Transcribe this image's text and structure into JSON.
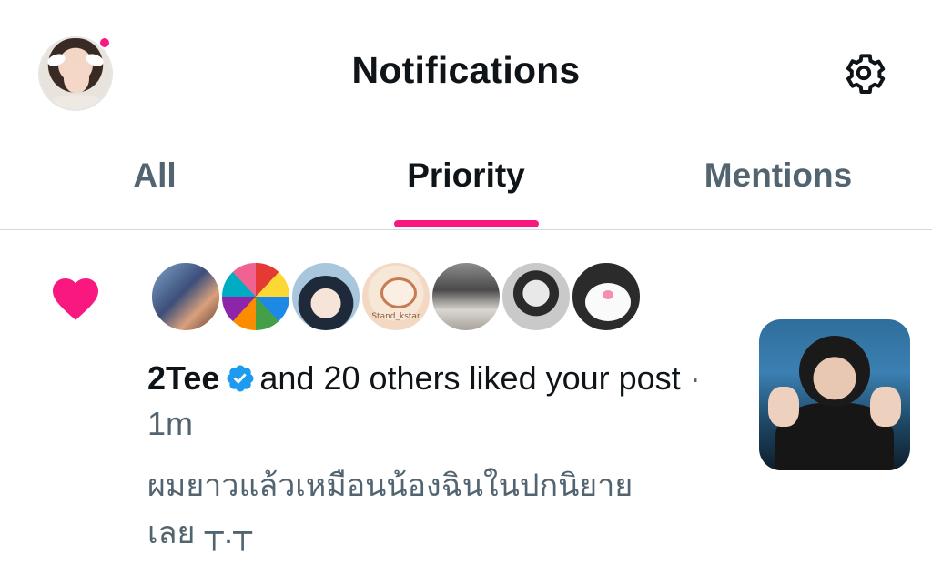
{
  "header": {
    "title": "Notifications",
    "has_unread_dot": true
  },
  "tabs": [
    {
      "label": "All",
      "active": false
    },
    {
      "label": "Priority",
      "active": true
    },
    {
      "label": "Mentions",
      "active": false
    }
  ],
  "notification": {
    "type_icon": "heart-icon",
    "username": "2Tee",
    "verified": true,
    "action_text": "and 20 others liked your post",
    "time_separator": "·",
    "time": "1m",
    "post_preview_line1": "ผมยาวแล้วเหมือนน้องฉินในปกนิยาย",
    "post_preview_line2": "เลย ┬.┬",
    "liker_avatars": [
      "avatar-1",
      "avatar-2",
      "avatar-3",
      "avatar-4",
      "avatar-5",
      "avatar-6",
      "avatar-7"
    ],
    "avatar_4_text": "Stand_kstar"
  },
  "colors": {
    "accent": "#f91880",
    "verified_blue": "#1d9bf0",
    "text_primary": "#0f1419",
    "text_secondary": "#536471",
    "divider": "#cfd9de"
  }
}
